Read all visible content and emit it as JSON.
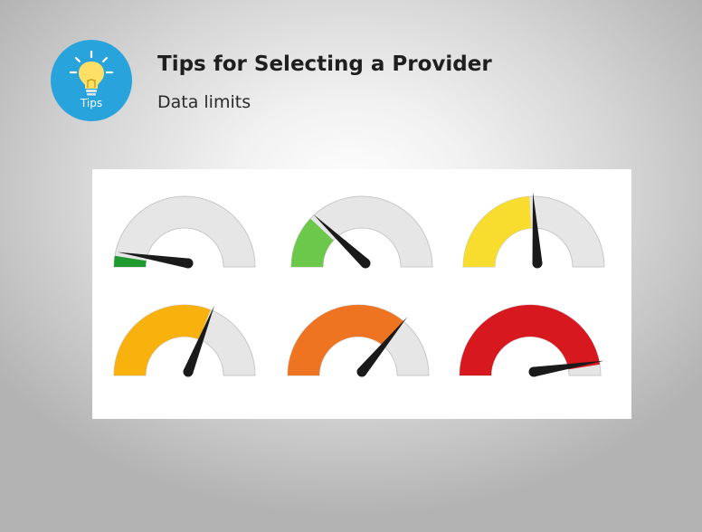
{
  "header": {
    "title": "Tips for Selecting a Provider",
    "subtitle": "Data limits",
    "badge_label": "Tips",
    "badge_icon": "lightbulb-icon",
    "badge_color": "#29a3dc"
  },
  "gauges": {
    "track_color": "#e6e6e6",
    "track_edge_color": "#c8c8c8",
    "needle_color": "#1a1a1a",
    "items": [
      {
        "name": "gauge-lowest",
        "level": 0.05,
        "color": "#1e9a2e"
      },
      {
        "name": "gauge-low",
        "level": 0.24,
        "color": "#6cc84b"
      },
      {
        "name": "gauge-half",
        "level": 0.48,
        "color": "#f8dc2e"
      },
      {
        "name": "gauge-above-half",
        "level": 0.62,
        "color": "#f9b10d"
      },
      {
        "name": "gauge-high",
        "level": 0.72,
        "color": "#ee7421"
      },
      {
        "name": "gauge-max",
        "level": 0.95,
        "color": "#d8181f"
      }
    ]
  }
}
